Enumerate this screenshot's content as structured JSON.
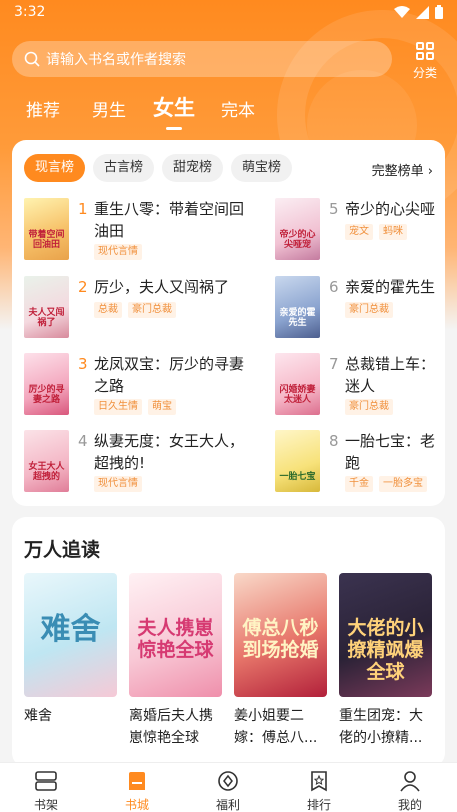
{
  "status": {
    "time": "3:32"
  },
  "search": {
    "placeholder": "请输入书名或作者搜索"
  },
  "category": {
    "label": "分类"
  },
  "tabs": [
    {
      "label": "推荐"
    },
    {
      "label": "男生"
    },
    {
      "label": "女生"
    },
    {
      "label": "完本"
    }
  ],
  "rank": {
    "chips": [
      {
        "label": "现言榜"
      },
      {
        "label": "古言榜"
      },
      {
        "label": "甜宠榜"
      },
      {
        "label": "萌宝榜"
      }
    ],
    "full_label": "完整榜单",
    "items": [
      {
        "num": "1",
        "title": "重生八零：带着空间回油田",
        "tags": [
          "现代言情"
        ],
        "cover_text": "带着空间回油田"
      },
      {
        "num": "2",
        "title": "厉少，夫人又闯祸了",
        "tags": [
          "总裁",
          "豪门总裁"
        ],
        "cover_text": "夫人又闯祸了"
      },
      {
        "num": "3",
        "title": "龙凤双宝：厉少的寻妻之路",
        "tags": [
          "日久生情",
          "萌宝"
        ],
        "cover_text": "厉少的寻妻之路"
      },
      {
        "num": "4",
        "title": "纵妻无度：女王大人，超拽的!",
        "tags": [
          "现代言情"
        ],
        "cover_text": "女王大人超拽的"
      },
      {
        "num": "5",
        "title": "帝少的心尖哑",
        "tags": [
          "宠文",
          "蚂咪"
        ],
        "cover_text": "帝少的心尖哑宠"
      },
      {
        "num": "6",
        "title": "亲爱的霍先生",
        "tags": [
          "豪门总裁"
        ],
        "cover_text": "亲爱的霍先生"
      },
      {
        "num": "7",
        "title": "总裁错上车：迷人",
        "tags": [
          "豪门总裁"
        ],
        "cover_text": "闪婚娇妻太迷人"
      },
      {
        "num": "8",
        "title": "一胎七宝：老跑",
        "tags": [
          "千金",
          "一胎多宝"
        ],
        "cover_text": "一胎七宝"
      }
    ]
  },
  "hot": {
    "title": "万人追读",
    "items": [
      {
        "name": "难舍",
        "cover_text": "难舍"
      },
      {
        "name": "离婚后夫人携崽惊艳全球",
        "cover_text": "夫人携崽惊艳全球"
      },
      {
        "name": "姜小姐要二嫁：傅总八...",
        "cover_text": "傅总八秒到场抢婚"
      },
      {
        "name": "重生团宠：大佬的小撩精...",
        "cover_text": "大佬的小撩精飒爆全球"
      }
    ]
  },
  "nav": [
    {
      "label": "书架"
    },
    {
      "label": "书城"
    },
    {
      "label": "福利"
    },
    {
      "label": "排行"
    },
    {
      "label": "我的"
    }
  ],
  "colors": {
    "accent": "#ff8a1f",
    "tag_text": "#f0903c",
    "tag_bg": "#fff2e6"
  }
}
